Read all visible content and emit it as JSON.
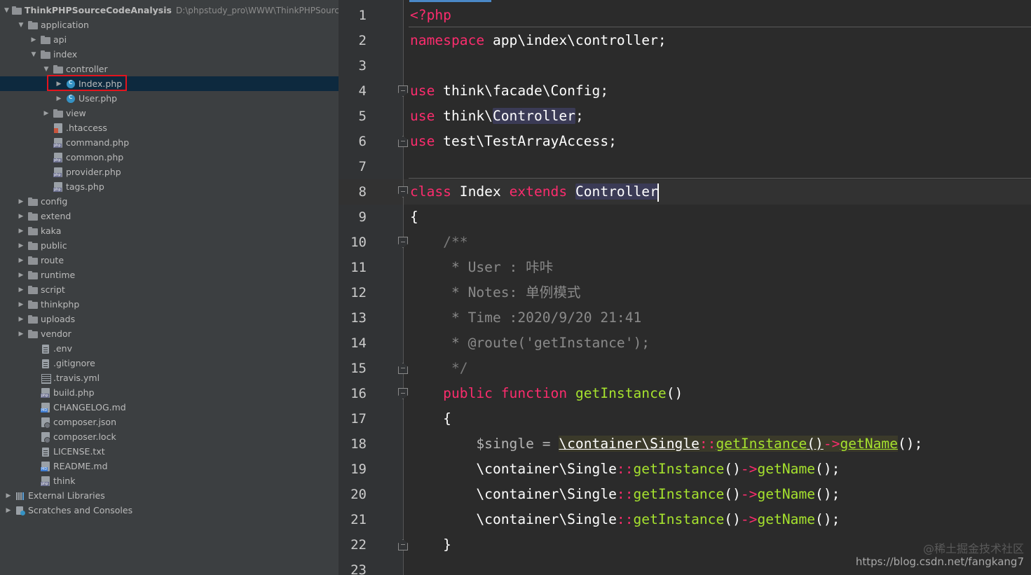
{
  "project": {
    "root_name": "ThinkPHPSourceCodeAnalysis",
    "root_path": "D:\\phpstudy_pro\\WWW\\ThinkPHPSourceCo",
    "items": [
      {
        "label": "application",
        "icon": "folder-icon",
        "expanded": true
      },
      {
        "label": "api",
        "icon": "folder-icon",
        "expanded": false
      },
      {
        "label": "index",
        "icon": "folder-icon",
        "expanded": true
      },
      {
        "label": "controller",
        "icon": "folder-icon",
        "expanded": true
      },
      {
        "label": "Index.php",
        "icon": "php-class-icon",
        "selected": true
      },
      {
        "label": "User.php",
        "icon": "php-class-icon"
      },
      {
        "label": "view",
        "icon": "folder-icon",
        "expanded": false
      },
      {
        "label": ".htaccess",
        "icon": "htaccess-file-icon"
      },
      {
        "label": "command.php",
        "icon": "php-file-icon"
      },
      {
        "label": "common.php",
        "icon": "php-file-icon"
      },
      {
        "label": "provider.php",
        "icon": "php-file-icon"
      },
      {
        "label": "tags.php",
        "icon": "php-file-icon"
      },
      {
        "label": "config",
        "icon": "folder-icon",
        "expanded": false
      },
      {
        "label": "extend",
        "icon": "folder-icon",
        "expanded": false
      },
      {
        "label": "kaka",
        "icon": "folder-icon",
        "expanded": false
      },
      {
        "label": "public",
        "icon": "folder-icon",
        "expanded": false
      },
      {
        "label": "route",
        "icon": "folder-icon",
        "expanded": false
      },
      {
        "label": "runtime",
        "icon": "folder-icon",
        "expanded": false
      },
      {
        "label": "script",
        "icon": "folder-icon",
        "expanded": false
      },
      {
        "label": "thinkphp",
        "icon": "folder-icon",
        "expanded": false
      },
      {
        "label": "uploads",
        "icon": "folder-icon",
        "expanded": false
      },
      {
        "label": "vendor",
        "icon": "folder-icon",
        "expanded": false
      },
      {
        "label": ".env",
        "icon": "text-file-icon"
      },
      {
        "label": ".gitignore",
        "icon": "text-file-icon"
      },
      {
        "label": ".travis.yml",
        "icon": "yml-file-icon"
      },
      {
        "label": "build.php",
        "icon": "php-file-icon"
      },
      {
        "label": "CHANGELOG.md",
        "icon": "markdown-file-icon"
      },
      {
        "label": "composer.json",
        "icon": "json-file-icon"
      },
      {
        "label": "composer.lock",
        "icon": "json-file-icon"
      },
      {
        "label": "LICENSE.txt",
        "icon": "text-file-icon"
      },
      {
        "label": "README.md",
        "icon": "markdown-file-icon"
      },
      {
        "label": "think",
        "icon": "php-file-icon"
      },
      {
        "label": "External Libraries",
        "icon": "libraries-icon",
        "expanded": false
      },
      {
        "label": "Scratches and Consoles",
        "icon": "scratches-icon",
        "expanded": false
      }
    ]
  },
  "editor": {
    "line_numbers": [
      "1",
      "2",
      "3",
      "4",
      "5",
      "6",
      "7",
      "8",
      "9",
      "10",
      "11",
      "12",
      "13",
      "14",
      "15",
      "16",
      "17",
      "18",
      "19",
      "20",
      "21",
      "22",
      "23"
    ],
    "tokens": {
      "php_open": "<?php",
      "namespace_kw": "namespace",
      "namespace_name": " app\\index\\controller;",
      "use_kw": "use",
      "use1": " think\\facade\\Config;",
      "use2_pre": " think\\",
      "use2_ref": "Controller",
      "use2_post": ";",
      "use3": " test\\TestArrayAccess;",
      "class_kw": "class",
      "class_name": " Index ",
      "extends_kw": "extends",
      "class_parent": "Controller",
      "open_brace": "{",
      "doc_open": "    /**",
      "doc_user": "     * User : 咔咔",
      "doc_notes": "     * Notes: 单例模式",
      "doc_time": "     * Time :2020/9/20 21:41",
      "doc_route": "     * @route('getInstance');",
      "doc_close": "     */",
      "public_kw": "    public",
      "function_kw": "function",
      "method_name": "getInstance",
      "parens": "()",
      "method_brace_open": "    {",
      "var_single": "        $single = ",
      "ns_class": "\\container\\Single",
      "scope_op": "::",
      "call_get_instance": "getInstance",
      "arrow_op": "->",
      "call_get_name": "getName",
      "stmt_end": "();",
      "indent8": "        ",
      "method_brace_close": "    }"
    }
  },
  "watermark": {
    "line1": "@稀土掘金技术社区",
    "line2": "https://blog.csdn.net/fangkang7"
  }
}
